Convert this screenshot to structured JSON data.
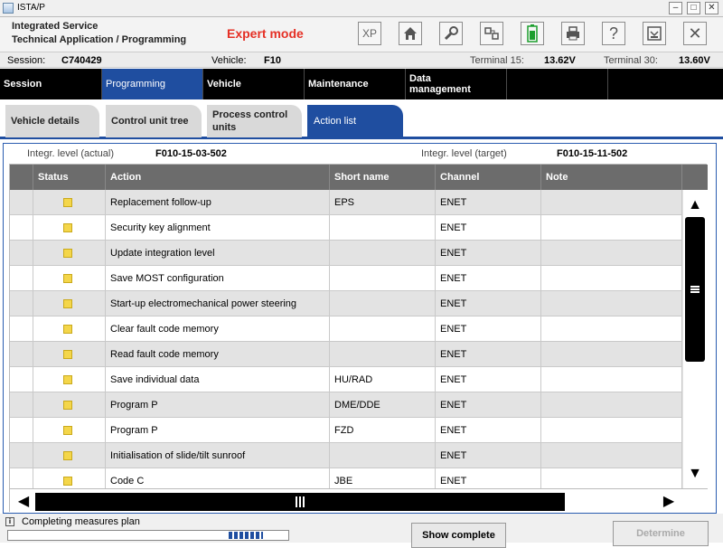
{
  "window": {
    "title": "ISTA/P"
  },
  "header": {
    "line1": "Integrated Service",
    "line2": "Technical Application / Programming",
    "mode": "Expert mode",
    "toolbar": [
      {
        "name": "xp-button",
        "label": "XP"
      },
      {
        "name": "home-button",
        "icon": "home-icon"
      },
      {
        "name": "wrench-button",
        "icon": "wrench-icon"
      },
      {
        "name": "connection-button",
        "icon": "connection-icon"
      },
      {
        "name": "battery-button",
        "icon": "battery-icon"
      },
      {
        "name": "print-button",
        "icon": "printer-icon"
      },
      {
        "name": "help-button",
        "label": "?"
      },
      {
        "name": "download-button",
        "icon": "download-icon"
      },
      {
        "name": "close-button",
        "label": "✕"
      }
    ]
  },
  "session": {
    "session_label": "Session:",
    "session_value": "C740429",
    "vehicle_label": "Vehicle:",
    "vehicle_value": "F10",
    "t15_label": "Terminal 15:",
    "t15_value": "13.62V",
    "t30_label": "Terminal 30:",
    "t30_value": "13.60V"
  },
  "nav": {
    "tabs": [
      "Session",
      "Programming",
      "Vehicle",
      "Maintenance",
      "Data management"
    ]
  },
  "subnav": {
    "tabs": [
      "Vehicle details",
      "Control unit tree",
      "Process control units",
      "Action list"
    ]
  },
  "integr": {
    "actual_label": "Integr. level (actual)",
    "actual_value": "F010-15-03-502",
    "target_label": "Integr. level (target)",
    "target_value": "F010-15-11-502"
  },
  "table": {
    "columns": [
      "Status",
      "Action",
      "Short name",
      "Channel",
      "Note"
    ],
    "rows": [
      {
        "action": "Replacement follow-up",
        "short": "EPS",
        "channel": "ENET",
        "note": ""
      },
      {
        "action": "Security key alignment",
        "short": "",
        "channel": "ENET",
        "note": ""
      },
      {
        "action": "Update integration level",
        "short": "",
        "channel": "ENET",
        "note": ""
      },
      {
        "action": "Save MOST configuration",
        "short": "",
        "channel": "ENET",
        "note": ""
      },
      {
        "action": "Start-up electromechanical power steering",
        "short": "",
        "channel": "ENET",
        "note": ""
      },
      {
        "action": "Clear fault code memory",
        "short": "",
        "channel": "ENET",
        "note": ""
      },
      {
        "action": "Read fault code memory",
        "short": "",
        "channel": "ENET",
        "note": ""
      },
      {
        "action": "Save individual data",
        "short": "HU/RAD",
        "channel": "ENET",
        "note": ""
      },
      {
        "action": "Program P",
        "short": "DME/DDE",
        "channel": "ENET",
        "note": ""
      },
      {
        "action": "Program P",
        "short": "FZD",
        "channel": "ENET",
        "note": ""
      },
      {
        "action": "Initialisation of slide/tilt sunroof",
        "short": "",
        "channel": "ENET",
        "note": ""
      },
      {
        "action": "Code C",
        "short": "JBE",
        "channel": "ENET",
        "note": ""
      }
    ]
  },
  "status": {
    "label": "Completing measures plan",
    "show_complete": "Show complete",
    "determine": "Determine",
    "progress_fill": 0.35
  }
}
